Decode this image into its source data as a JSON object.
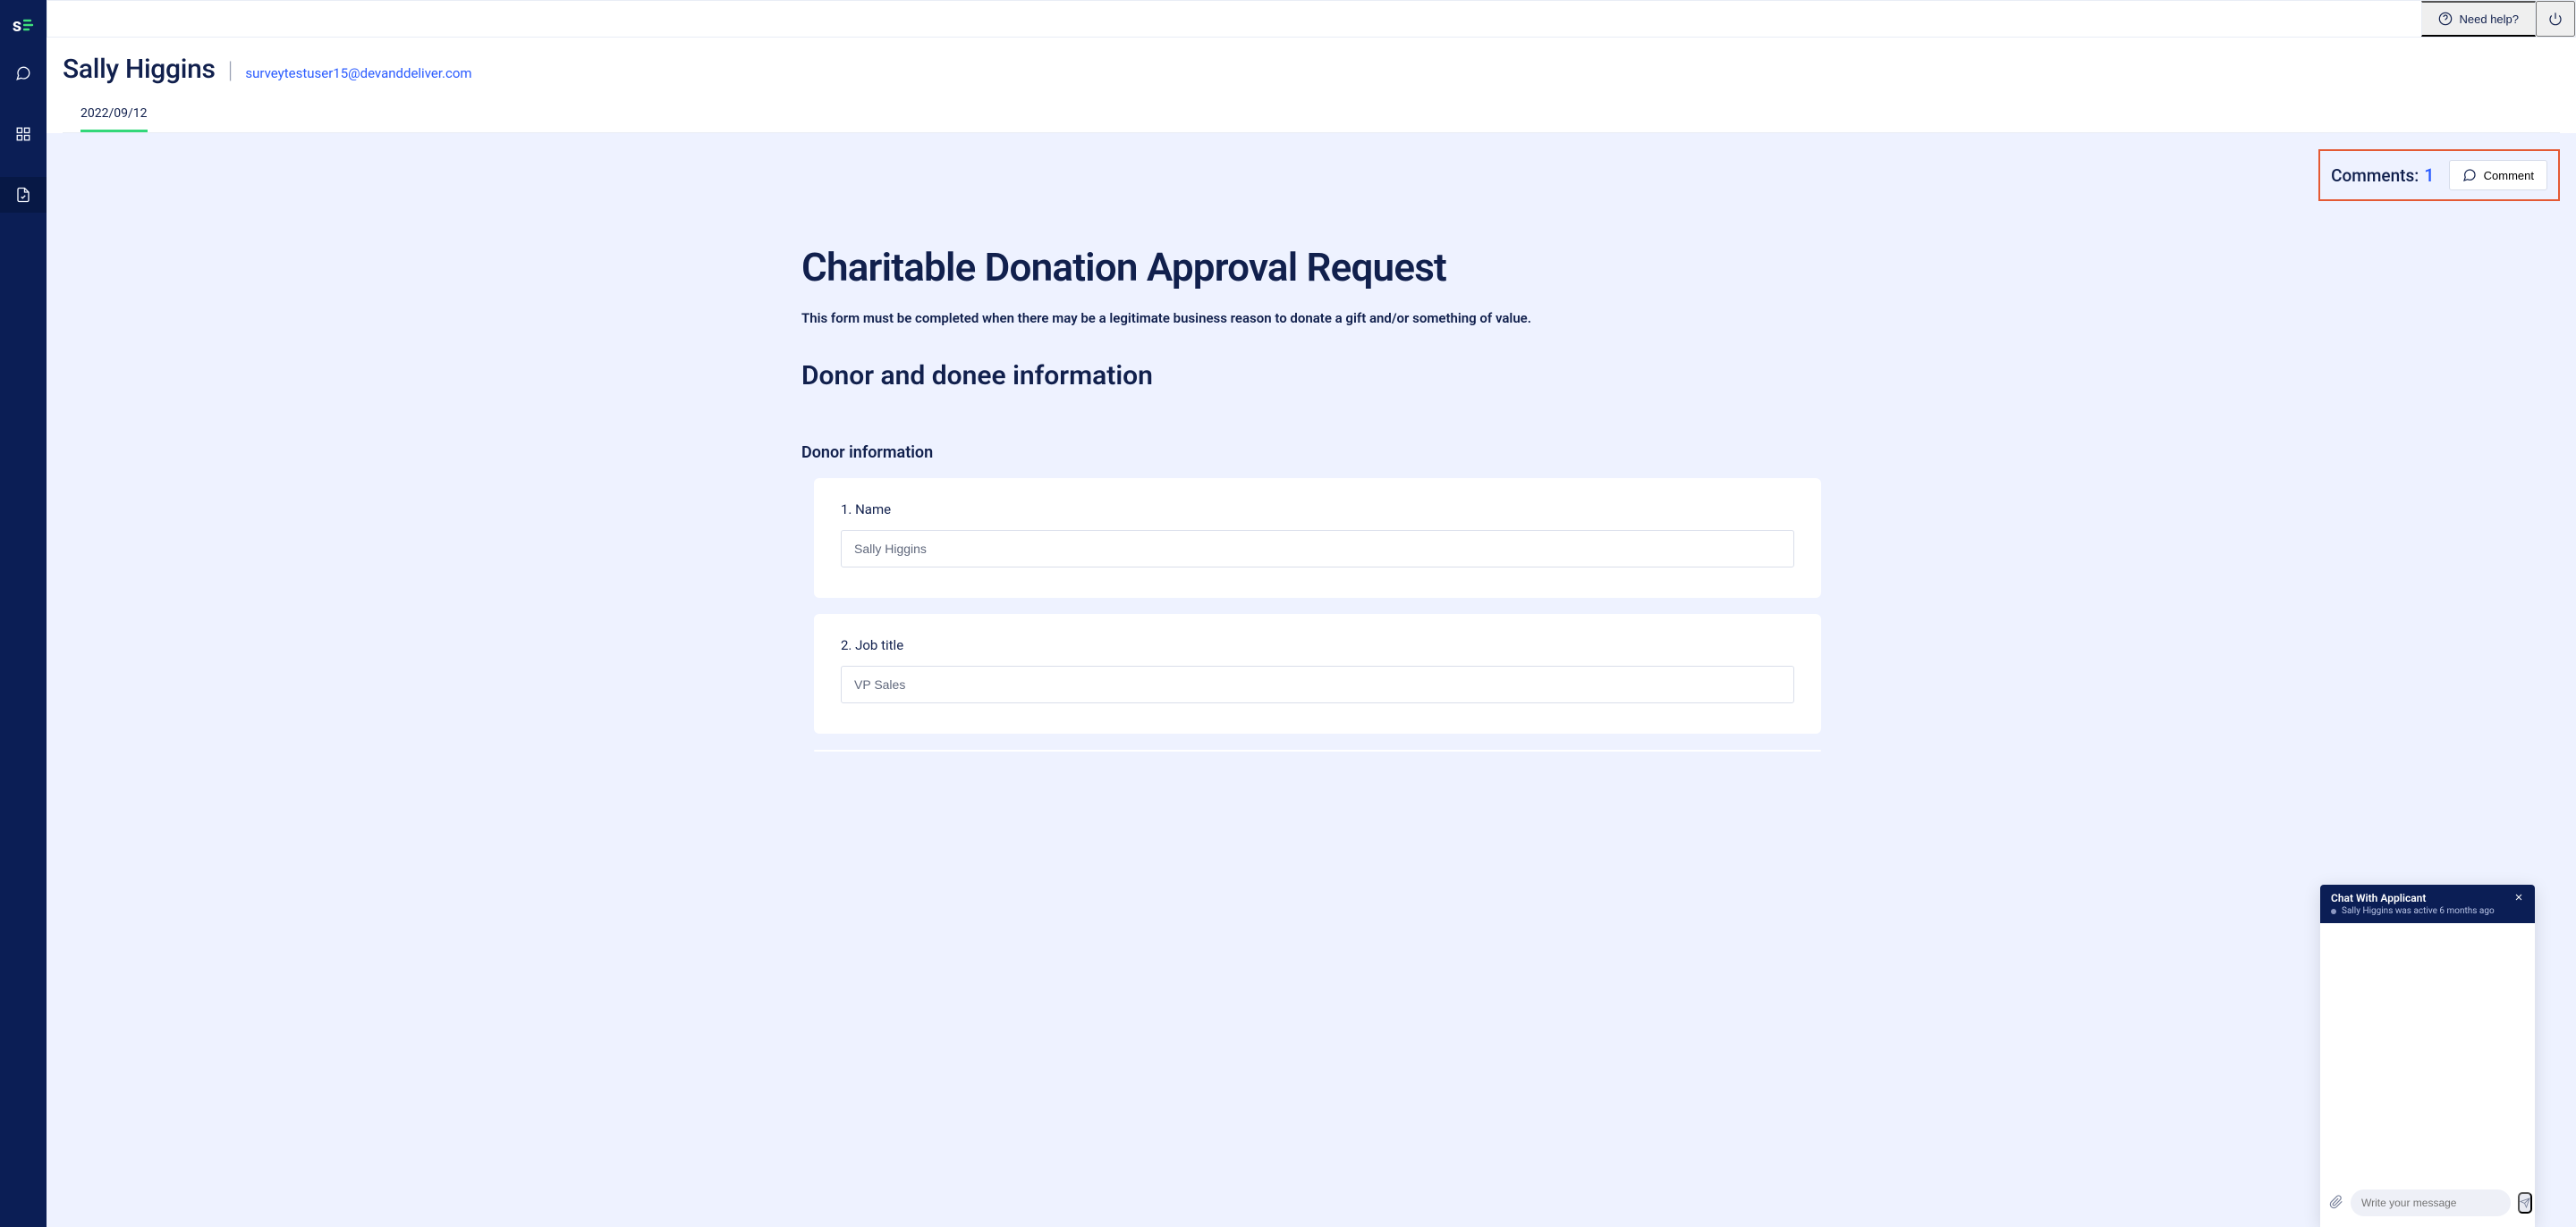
{
  "sidebar": {
    "logo_text": "s"
  },
  "topbar": {
    "need_help": "Need help?"
  },
  "header": {
    "name": "Sally Higgins",
    "divider": "|",
    "email": "surveytestuser15@devanddeliver.com"
  },
  "tabs": [
    {
      "label": "2022/09/12"
    }
  ],
  "comments": {
    "label": "Comments:",
    "count": "1",
    "button": "Comment"
  },
  "form": {
    "title": "Charitable Donation Approval Request",
    "subtitle": "This form must be completed when there may be a legitimate business reason to donate a gift and/or something of value.",
    "section_title": "Donor and donee information",
    "subsection_title": "Donor information",
    "questions": [
      {
        "label": "1. Name",
        "value": "Sally Higgins"
      },
      {
        "label": "2. Job title",
        "value": "VP Sales"
      }
    ]
  },
  "chat": {
    "title": "Chat With Applicant",
    "status": "Sally Higgins was active 6 months ago",
    "placeholder": "Write your message"
  }
}
